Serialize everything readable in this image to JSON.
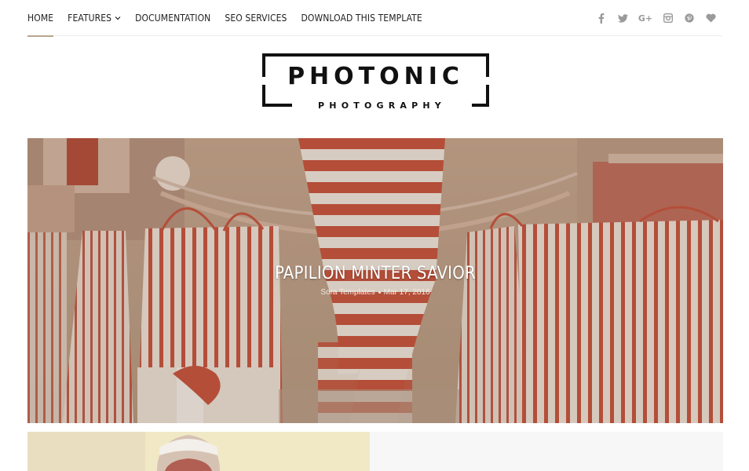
{
  "nav": {
    "items": [
      {
        "label": "Home",
        "active": true
      },
      {
        "label": "Features",
        "has_dropdown": true
      },
      {
        "label": "Documentation"
      },
      {
        "label": "SEO Services"
      },
      {
        "label": "Download This Template"
      }
    ]
  },
  "social": {
    "icons": [
      "facebook-icon",
      "twitter-icon",
      "google-plus-icon",
      "instagram-icon",
      "pinterest-icon",
      "heart-icon"
    ],
    "gplus_glyph": "G+"
  },
  "logo": {
    "title": "PHOTONIC",
    "subtitle": "PHOTOGRAPHY"
  },
  "featured": {
    "title": "Papilion Minter Savior",
    "author": "Sora Templates",
    "date": "Mar 17, 2016"
  },
  "colors": {
    "nav_active_underline": "#b9a58c",
    "icon_gray": "#9a9a9a",
    "stripe_red": "#c9553f",
    "stripe_cream": "#f2e9df"
  }
}
